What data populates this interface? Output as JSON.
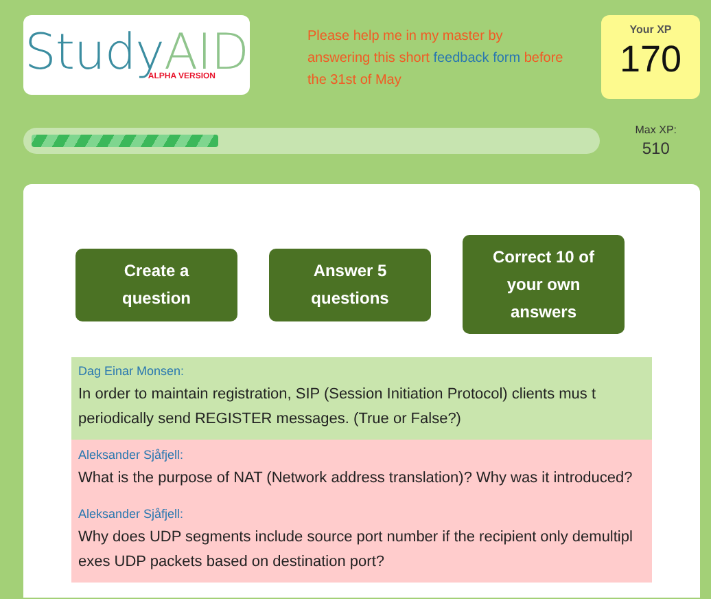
{
  "logo": {
    "first": "Study",
    "second": "AID",
    "tag": "ALPHA VERSION"
  },
  "notice": {
    "before": "Please help me in my master by answering this short",
    "link": "feedback form",
    "after": "before the 31st of May"
  },
  "xp": {
    "label": "Your XP",
    "value": "170"
  },
  "progress": {
    "level": 0.333,
    "max_label": "Max XP:",
    "max_value": "510"
  },
  "tasks": [
    "Create a question",
    "Answer 5 questions",
    "Correct 10 of your own answers"
  ],
  "questions": [
    {
      "author": "Dag Einar Monsen:",
      "text": "In order to maintain registration, SIP (Session Initiation Protocol) clients mus t periodically send REGISTER messages. (True or False?)",
      "color": "#c9e5ad"
    },
    {
      "author": "Aleksander Sjåfjell:",
      "text": "What is the purpose of NAT (Network address translation)? Why was it introduced?",
      "color": "#ffcccc"
    },
    {
      "author": "Aleksander Sjåfjell:",
      "text": "Why does UDP segments include source port number if the recipient only demultipl exes UDP packets based on destination port?",
      "color": "#ffcccc"
    }
  ]
}
